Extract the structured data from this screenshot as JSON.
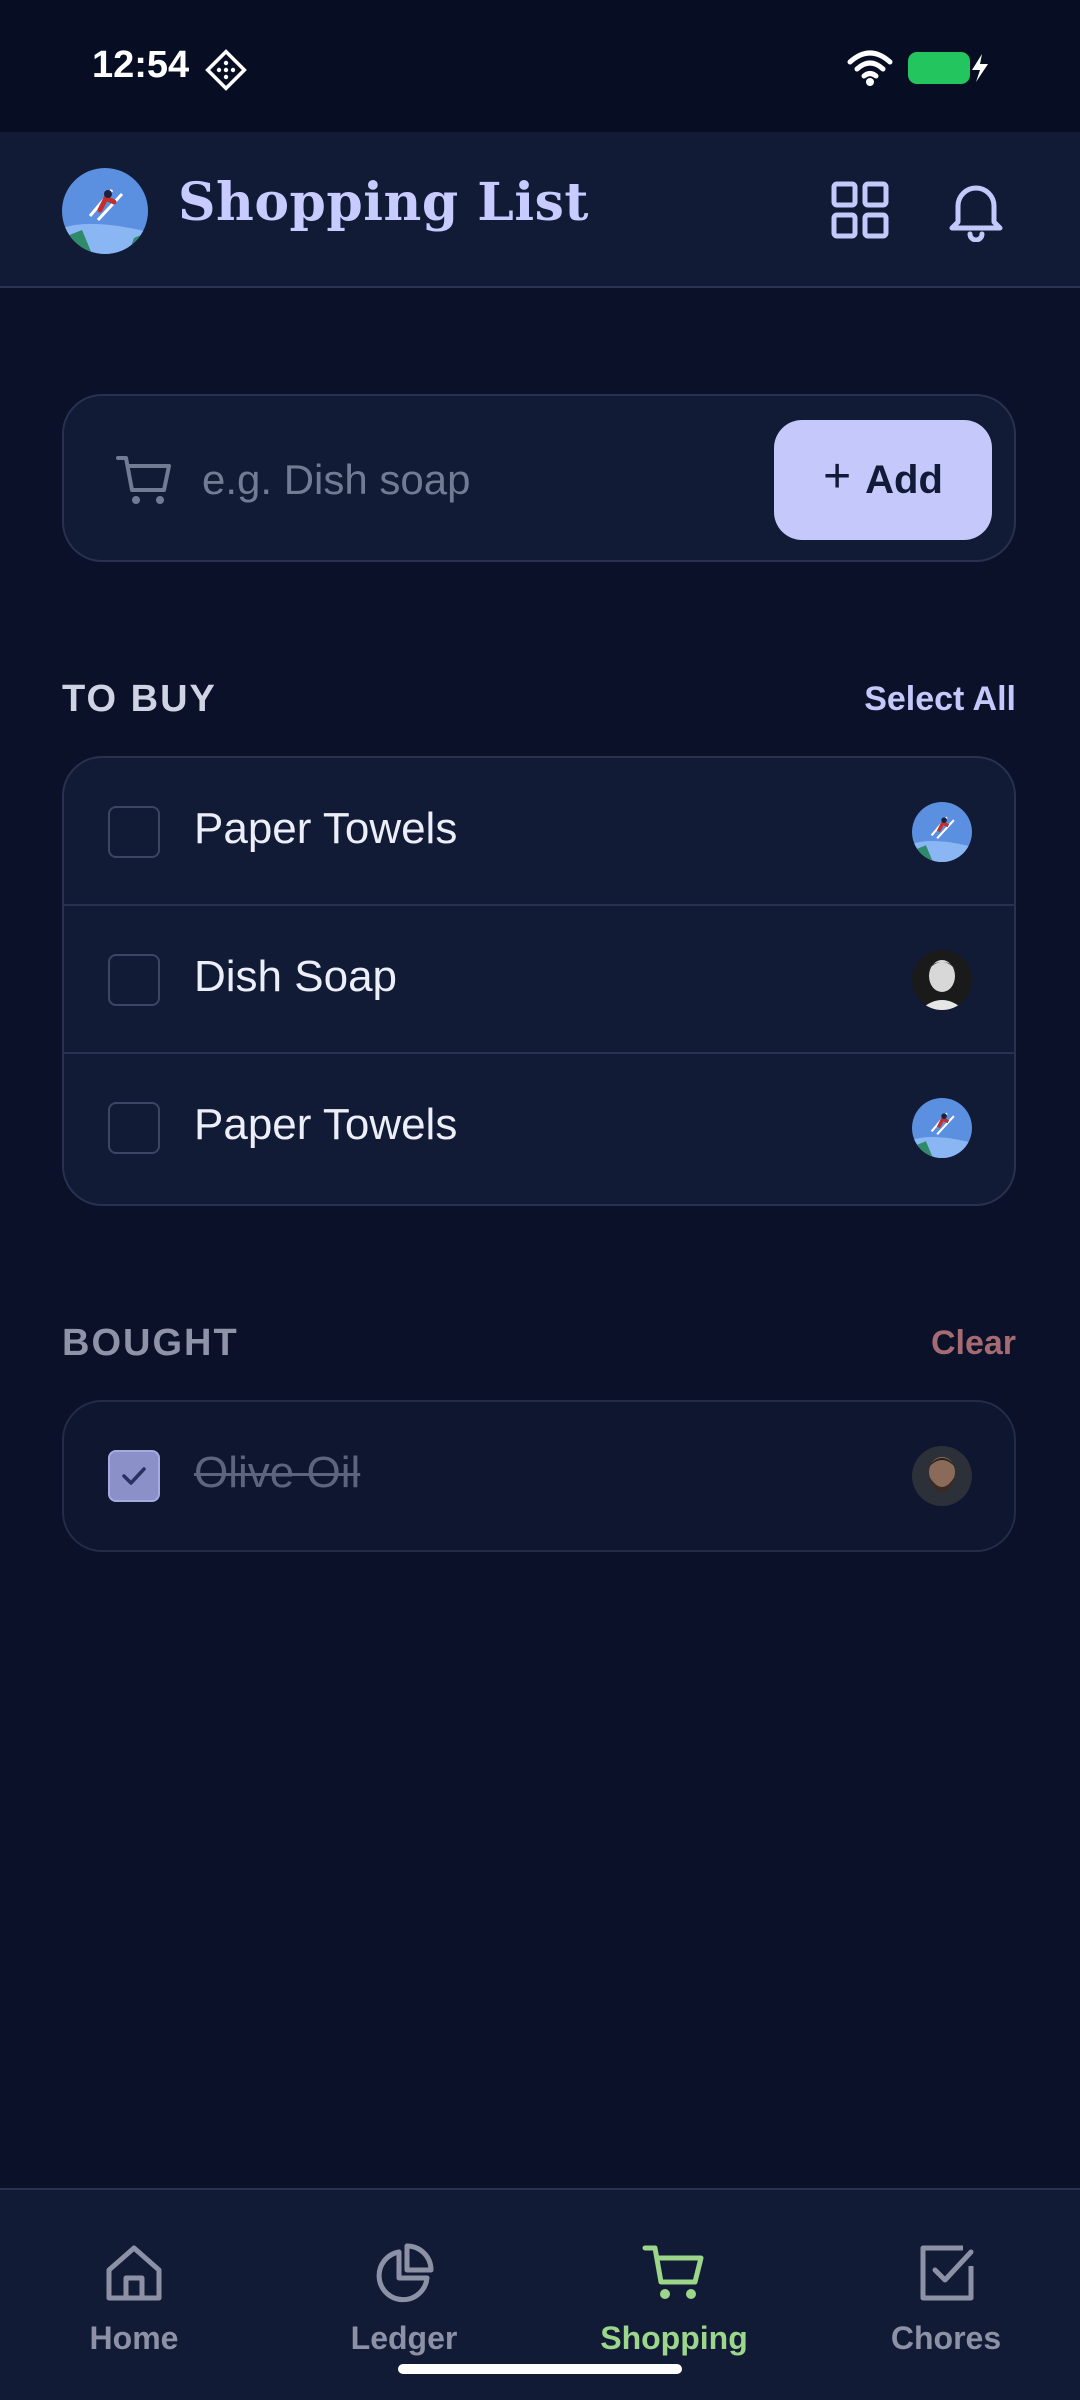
{
  "status_bar": {
    "time": "12:54",
    "icons": [
      "diamond-dots-icon",
      "wifi-icon",
      "battery-charging-icon"
    ],
    "battery_color": "#22c55e"
  },
  "header": {
    "title": "Shopping List",
    "avatar": "ski-jumper-avatar",
    "icons": [
      "grid-icon",
      "bell-icon"
    ]
  },
  "add_bar": {
    "placeholder": "e.g. Dish soap",
    "value": "",
    "button_label": "Add",
    "button_icon": "plus-icon"
  },
  "to_buy": {
    "title": "TO BUY",
    "action": "Select All",
    "items": [
      {
        "label": "Paper Towels",
        "checked": false,
        "avatar": "ski-jumper-avatar"
      },
      {
        "label": "Dish Soap",
        "checked": false,
        "avatar": "man-portrait-avatar"
      },
      {
        "label": "Paper Towels",
        "checked": false,
        "avatar": "ski-jumper-avatar"
      }
    ]
  },
  "bought": {
    "title": "BOUGHT",
    "action": "Clear",
    "items": [
      {
        "label": "Olive Oil",
        "checked": true,
        "avatar": "bearded-man-avatar"
      }
    ]
  },
  "bottom_nav": {
    "items": [
      {
        "label": "Home",
        "icon": "home-icon",
        "active": false
      },
      {
        "label": "Ledger",
        "icon": "pie-chart-icon",
        "active": false
      },
      {
        "label": "Shopping",
        "icon": "cart-icon",
        "active": true
      },
      {
        "label": "Chores",
        "icon": "checkbox-icon",
        "active": false
      }
    ]
  },
  "colors": {
    "background": "#0a1128",
    "surface": "#121b36",
    "accent": "#c4c8fb",
    "active_nav": "#9bd68a",
    "clear": "#a56a72"
  }
}
